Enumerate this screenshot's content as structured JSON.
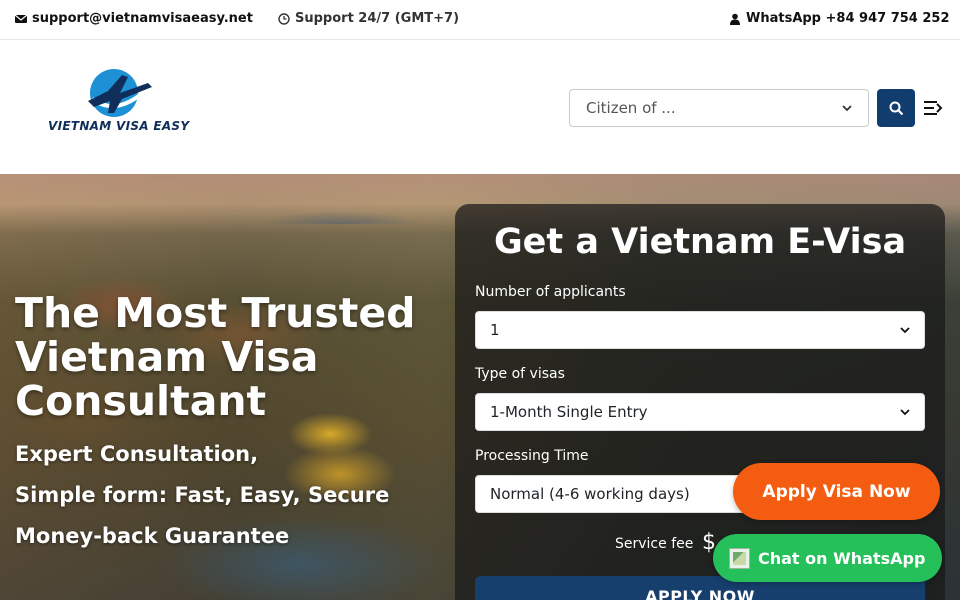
{
  "topbar": {
    "email": "support@vietnamvisaeasy.net",
    "support": "Support 24/7 (GMT+7)",
    "whatsapp": "WhatsApp +84 947 754 252"
  },
  "header": {
    "logo_text": "VIETNAM VISA EASY",
    "citizen_placeholder": "Citizen of ...",
    "search_icon": "search-icon",
    "menu_icon": "menu-icon"
  },
  "hero": {
    "title": "The Most Trusted Vietnam Visa Consultant",
    "lines": [
      "Expert Consultation,",
      "Simple form: Fast, Easy, Secure",
      "Money-back Guarantee"
    ]
  },
  "form": {
    "title": "Get a Vietnam E-Visa",
    "applicants_label": "Number of applicants",
    "applicants_value": "1",
    "visa_type_label": "Type of visas",
    "visa_type_value": "1-Month Single Entry",
    "processing_label": "Processing Time",
    "processing_value": "Normal (4-6 working days)",
    "fee_label": "Service fee",
    "fee_symbol": "$",
    "apply_button": "APPLY NOW"
  },
  "floating": {
    "apply_visa": "Apply Visa Now",
    "whatsapp_chat": "Chat on WhatsApp"
  },
  "colors": {
    "brand_navy": "#113d6e",
    "apply_orange": "#f45d11",
    "whatsapp_green": "#25c05a"
  }
}
